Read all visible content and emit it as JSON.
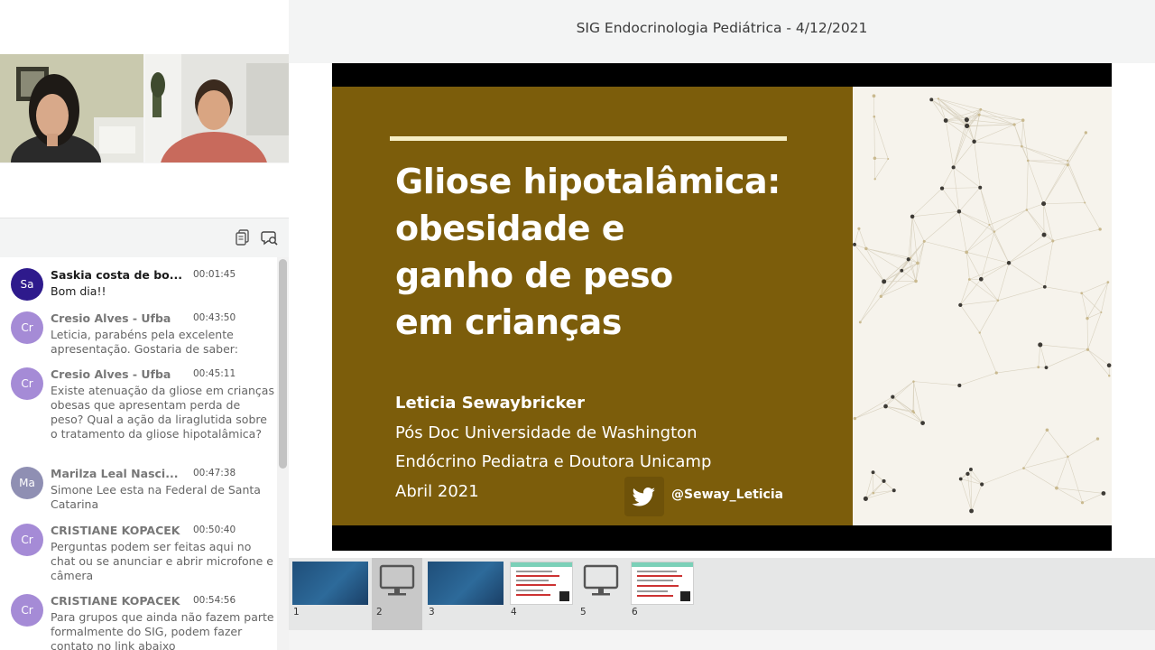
{
  "header": {
    "title": "SIG Endocrinologia Pediátrica - 4/12/2021"
  },
  "chat": {
    "messages": [
      {
        "initials": "Sa",
        "name": "Saskia costa de bo...",
        "time": "00:01:45",
        "text": "Bom dia!!",
        "color": "#2e1a8c"
      },
      {
        "initials": "Cr",
        "name": "Cresio Alves - Ufba",
        "time": "00:43:50",
        "text": "Leticia, parabéns pela excelente apresentação. Gostaria de saber:",
        "color": "#a58bd6"
      },
      {
        "initials": "Cr",
        "name": "Cresio Alves - Ufba",
        "time": "00:45:11",
        "text": "Existe atenuação da gliose em crianças obesas que apresentam perda de peso? Qual a ação da liraglutida sobre o tratamento da gliose hipotalâmica?",
        "color": "#a58bd6"
      },
      {
        "initials": "Ma",
        "name": "Marilza Leal Nasci...",
        "time": "00:47:38",
        "text": "Simone Lee esta na Federal de Santa Catarina",
        "color": "#8f8fb3"
      },
      {
        "initials": "Cr",
        "name": "CRISTIANE KOPACEK",
        "time": "00:50:40",
        "text": "Perguntas podem ser feitas aqui no chat ou se anunciar e abrir microfone e câmera",
        "color": "#a58bd6"
      },
      {
        "initials": "Cr",
        "name": "CRISTIANE KOPACEK",
        "time": "00:54:56",
        "text": "Para grupos que ainda não fazem parte formalmente do SIG, podem fazer contato no link abaixo",
        "color": "#a58bd6"
      }
    ]
  },
  "slide": {
    "title_lines": [
      "Gliose hipotalâmica:",
      "obesidade e",
      "ganho de peso",
      "em crianças"
    ],
    "author": "Leticia Sewaybricker",
    "line1": "Pós Doc Universidade de Washington",
    "line2": "Endócrino Pediatra e Doutora Unicamp",
    "line3": "Abril 2021",
    "handle": "@Seway_Leticia",
    "accent_color": "#7c5d0b"
  },
  "thumbnails": [
    {
      "num": "1",
      "kind": "blue"
    },
    {
      "num": "2",
      "kind": "screen",
      "selected": true
    },
    {
      "num": "3",
      "kind": "blue"
    },
    {
      "num": "4",
      "kind": "doc"
    },
    {
      "num": "5",
      "kind": "screen"
    },
    {
      "num": "6",
      "kind": "doc"
    }
  ]
}
